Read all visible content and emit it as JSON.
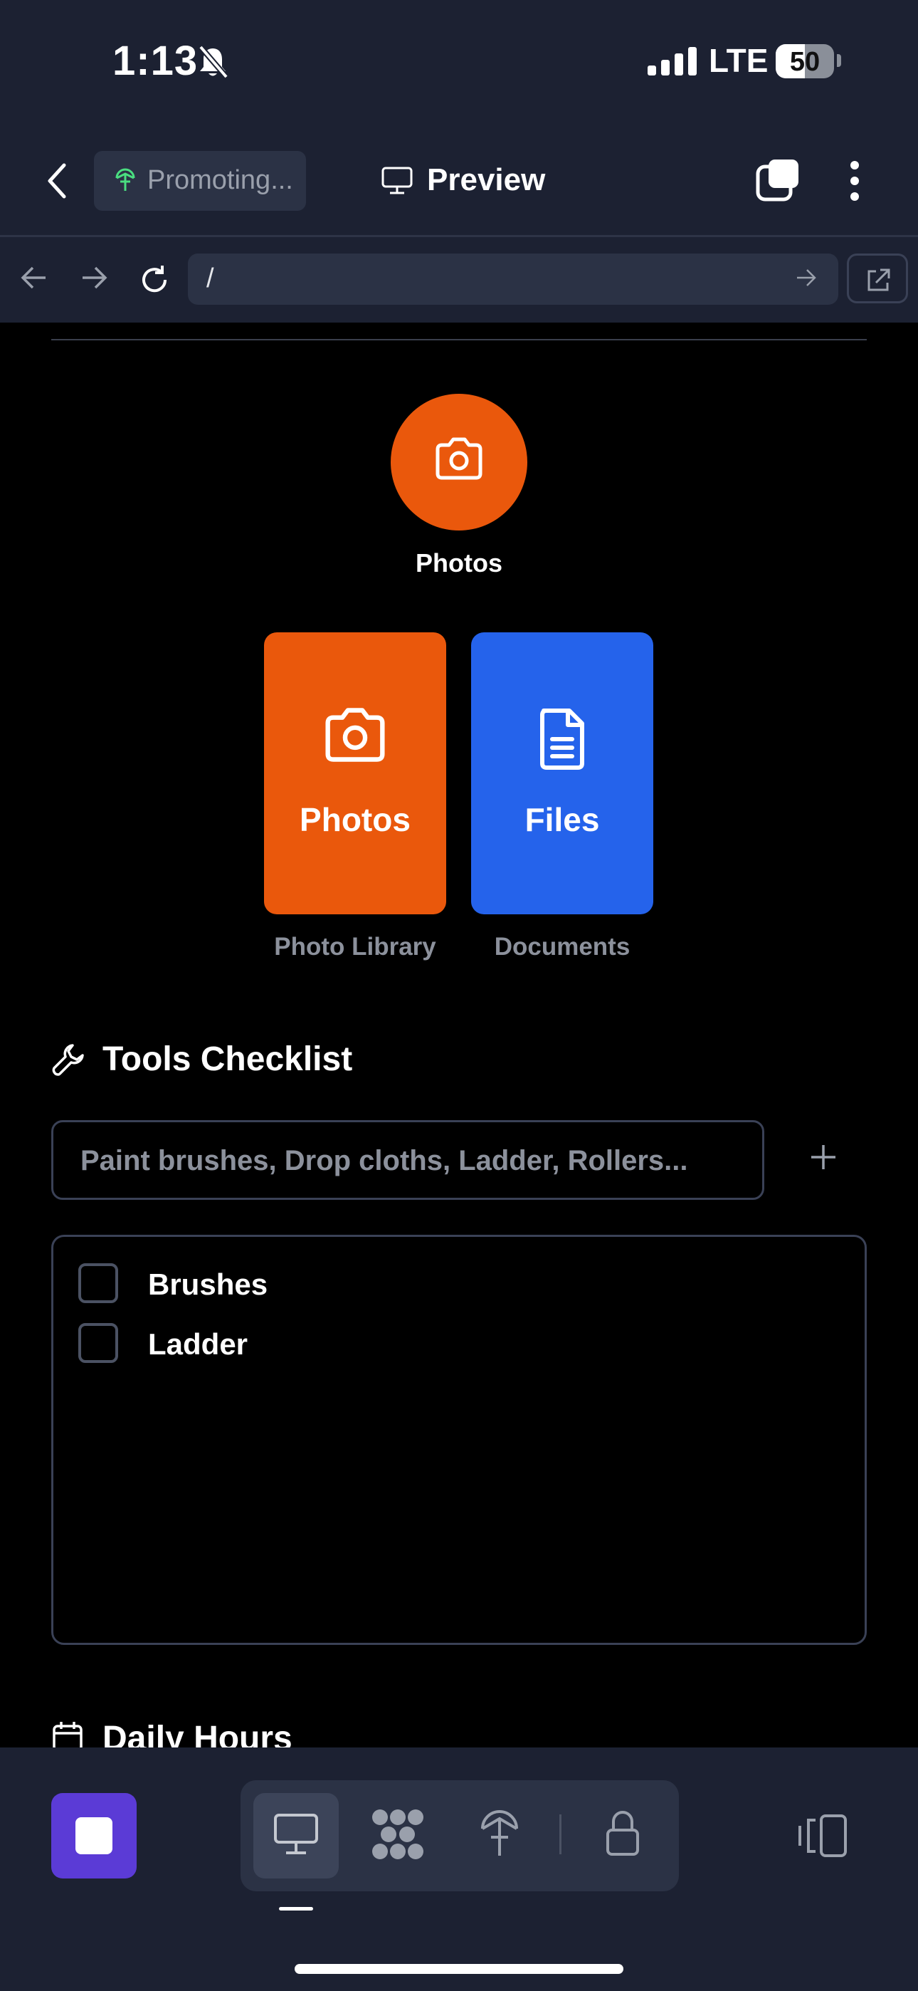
{
  "status_bar": {
    "time": "1:13",
    "network": "LTE",
    "battery_level": "50",
    "battery_fraction": 0.5
  },
  "header": {
    "project_name": "Promoting...",
    "mode_label": "Preview"
  },
  "address_bar": {
    "url": "/"
  },
  "upload": {
    "camera_label": "Photos",
    "cards": [
      {
        "label": "Photos",
        "sublabel": "Photo Library",
        "color": "#ea580c"
      },
      {
        "label": "Files",
        "sublabel": "Documents",
        "color": "#2563eb"
      }
    ]
  },
  "tools": {
    "title": "Tools Checklist",
    "input_placeholder": "Paint brushes, Drop cloths, Ladder, Rollers...",
    "items": [
      {
        "label": "Brushes",
        "checked": false
      },
      {
        "label": "Ladder",
        "checked": false
      }
    ]
  },
  "daily_hours": {
    "title": "Daily Hours"
  },
  "colors": {
    "chrome_bg": "#1c2132",
    "accent_purple": "#5b3bd6",
    "orange": "#ea580c",
    "blue": "#2563eb"
  }
}
